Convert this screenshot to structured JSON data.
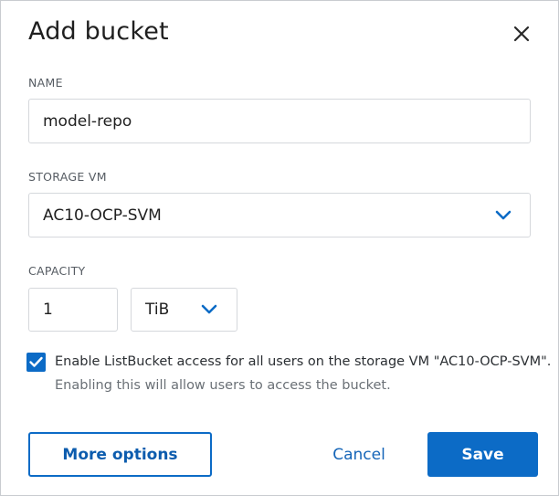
{
  "dialog": {
    "title": "Add bucket",
    "close_icon": "close-icon"
  },
  "name": {
    "label": "NAME",
    "value": "model-repo"
  },
  "storage_vm": {
    "label": "STORAGE VM",
    "selected": "AC10-OCP-SVM",
    "icon": "chevron-down-icon"
  },
  "capacity": {
    "label": "CAPACITY",
    "value": "1",
    "unit": "TiB",
    "unit_icon": "chevron-down-icon"
  },
  "listbucket": {
    "checked": true,
    "label": "Enable ListBucket access for all users on the storage VM \"AC10-OCP-SVM\".",
    "hint": "Enabling this will allow users to access the bucket."
  },
  "actions": {
    "more_options": "More options",
    "cancel": "Cancel",
    "save": "Save"
  },
  "colors": {
    "accent": "#0c6bc6",
    "link": "#1565b8",
    "border": "#d5d8dc"
  }
}
